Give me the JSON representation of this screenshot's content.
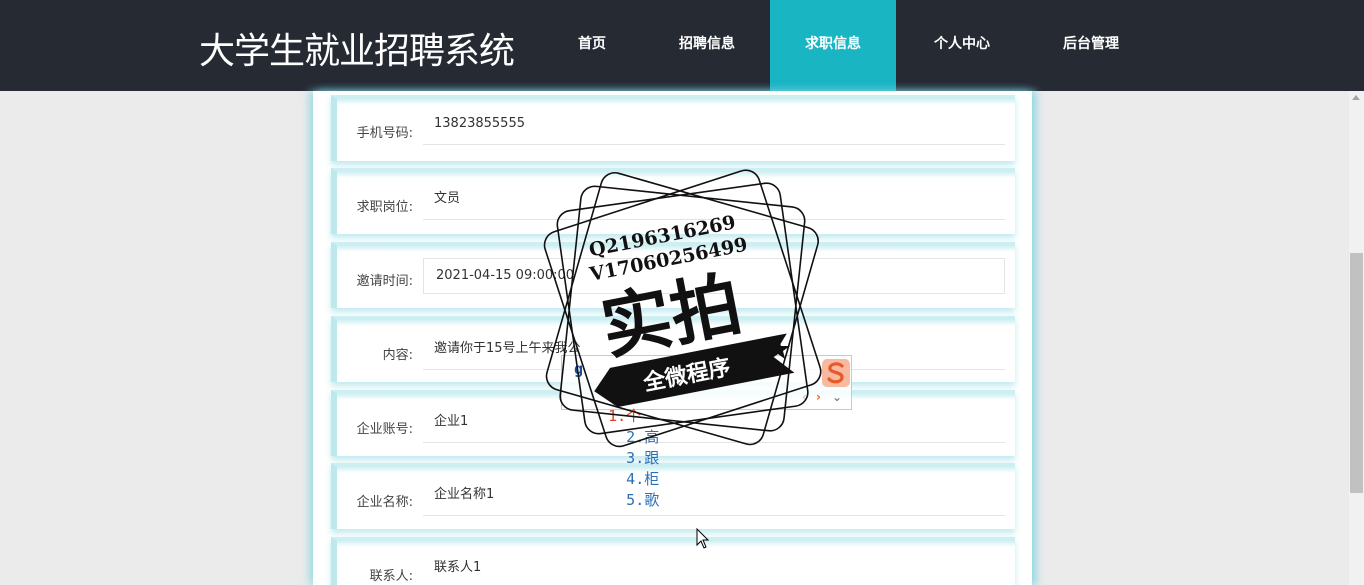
{
  "header": {
    "site_title": "大学生就业招聘系统",
    "nav": [
      {
        "label": "首页",
        "active": false
      },
      {
        "label": "招聘信息",
        "active": false
      },
      {
        "label": "求职信息",
        "active": true
      },
      {
        "label": "个人中心",
        "active": false
      },
      {
        "label": "后台管理",
        "active": false
      }
    ],
    "active_color": "#1ab5c3",
    "bg_color": "#262a33"
  },
  "form": {
    "rows": [
      {
        "label": "手机号码:",
        "value": "13823855555"
      },
      {
        "label": "求职岗位:",
        "value": "文员"
      },
      {
        "label": "邀请时间:",
        "value": "2021-04-15 09:00:00"
      },
      {
        "label": "内容:",
        "value": "邀请你于15号上午来我公"
      },
      {
        "label": "企业账号:",
        "value": "企业1"
      },
      {
        "label": "企业名称:",
        "value": "企业名称1"
      },
      {
        "label": "联系人:",
        "value": "联系人1"
      }
    ]
  },
  "watermark": {
    "line1": "Q2196316269",
    "line2": "V17060256499",
    "main": "实拍",
    "ribbon": "全微程序"
  },
  "ime": {
    "composition": "g",
    "candidates": [
      "1.个",
      "2.高",
      "3.跟",
      "4.柜",
      "5.歌"
    ],
    "prev_icon": "chevron-left-icon",
    "next_icon": "chevron-right-icon",
    "expand_icon": "chevron-down-icon"
  }
}
